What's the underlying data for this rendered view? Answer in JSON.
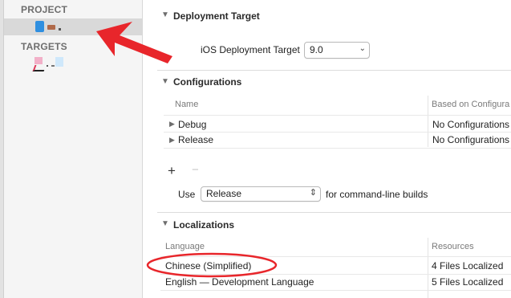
{
  "sidebar": {
    "project_header": "PROJECT",
    "targets_header": "TARGETS"
  },
  "deployment": {
    "title": "Deployment Target",
    "ios_label": "iOS Deployment Target",
    "ios_value": "9.0"
  },
  "configurations": {
    "title": "Configurations",
    "col_name": "Name",
    "col_based": "Based on Configura",
    "rows": [
      {
        "name": "Debug",
        "based": "No Configurations"
      },
      {
        "name": "Release",
        "based": "No Configurations"
      }
    ],
    "add_symbol": "+",
    "remove_symbol": "−",
    "use_label": "Use",
    "use_value": "Release",
    "use_suffix": "for command-line builds"
  },
  "localizations": {
    "title": "Localizations",
    "col_language": "Language",
    "col_resources": "Resources",
    "rows": [
      {
        "language": "Chinese (Simplified)",
        "resources": "4 Files Localized"
      },
      {
        "language": "English — Development Language",
        "resources": "5 Files Localized"
      }
    ]
  },
  "annotation_colors": {
    "arrow": "#e8262b",
    "ellipse": "#e8262b"
  }
}
